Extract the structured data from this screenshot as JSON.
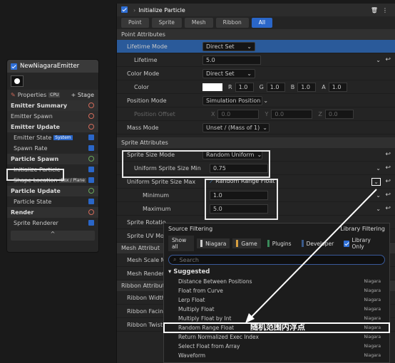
{
  "emitter": {
    "title": "NewNiagaraEmitter",
    "properties": "Properties",
    "cpu": "CPU",
    "stage": "+ Stage",
    "rows": [
      {
        "label": "Emitter Summary",
        "kind": "sec"
      },
      {
        "label": "Emitter Spawn",
        "kind": "sub"
      },
      {
        "label": "Emitter Update",
        "kind": "sec"
      },
      {
        "label": "Emitter State",
        "kind": "item",
        "tag": "System"
      },
      {
        "label": "Spawn Rate",
        "kind": "item"
      },
      {
        "label": "Particle Spawn",
        "kind": "sec"
      },
      {
        "label": "Initialize Particle",
        "kind": "item"
      },
      {
        "label": "Shape Location",
        "kind": "item",
        "tag": "Box / Plane"
      },
      {
        "label": "Particle Update",
        "kind": "sec"
      },
      {
        "label": "Particle State",
        "kind": "item"
      },
      {
        "label": "Render",
        "kind": "sec"
      },
      {
        "label": "Sprite Renderer",
        "kind": "item"
      }
    ],
    "collapse": "^"
  },
  "panel": {
    "title": "Initialize Particle",
    "tabs": [
      "Point",
      "Sprite",
      "Mesh",
      "Ribbon",
      "All"
    ],
    "point_attributes": "Point Attributes",
    "lifetime_mode": "Lifetime Mode",
    "direct_set": "Direct Set",
    "lifetime": "Lifetime",
    "lifetime_val": "5.0",
    "color_mode": "Color Mode",
    "color": "Color",
    "r": "R",
    "g": "G",
    "b": "B",
    "a": "A",
    "one": "1.0",
    "position_mode": "Position Mode",
    "sim_position": "Simulation Position",
    "position_offset": "Position Offset",
    "x": "X",
    "y": "Y",
    "z": "Z",
    "zero": "0.0",
    "mass_mode": "Mass Mode",
    "mass_val": "Unset / (Mass of 1)",
    "sprite_attributes": "Sprite Attributes",
    "sprite_size_mode": "Sprite Size Mode",
    "random_uniform": "Random Uniform",
    "uniform_min": "Uniform Sprite Size Min",
    "uniform_min_val": "0.75",
    "uniform_max": "Uniform Sprite Size Max",
    "random_range_float": "Random Range Float",
    "minimum": "Minimum",
    "min_val": "1.0",
    "maximum": "Maximum",
    "max_val": "5.0",
    "sprite_rotation": "Sprite Rotatio",
    "sprite_uv": "Sprite UV Mod",
    "mesh_attr": "Mesh Attribut",
    "mesh_scale": "Mesh Scale M",
    "mesh_render": "Mesh Rendere",
    "ribbon_attr": "Ribbon Attribut",
    "ribbon_width": "Ribbon Width M",
    "ribbon_facing": "Ribbon Facing",
    "ribbon_twist": "Ribbon Twist M"
  },
  "popup": {
    "source_filtering": "Source Filtering",
    "library_filtering": "Library Filtering",
    "show_all": "Show all",
    "niagara": "Niagara",
    "game": "Game",
    "plugins": "Plugins",
    "developer": "Developer",
    "library_only": "Library Only",
    "search_placeholder": "Search",
    "suggested": "Suggested",
    "items": [
      {
        "label": "Distance Between Positions",
        "src": "Niagara"
      },
      {
        "label": "Float from Curve",
        "src": "Niagara"
      },
      {
        "label": "Lerp Float",
        "src": "Niagara"
      },
      {
        "label": "Multiply Float",
        "src": "Niagara"
      },
      {
        "label": "Multiply Float by Int",
        "src": "Niagara"
      },
      {
        "label": "Random Range Float",
        "src": "Niagara"
      },
      {
        "label": "Return Normalized Exec Index",
        "src": "Niagara"
      },
      {
        "label": "Select Float from Array",
        "src": "Niagara"
      },
      {
        "label": "Waveform",
        "src": "Niagara"
      }
    ]
  },
  "annotation": "随机范围内浮点"
}
